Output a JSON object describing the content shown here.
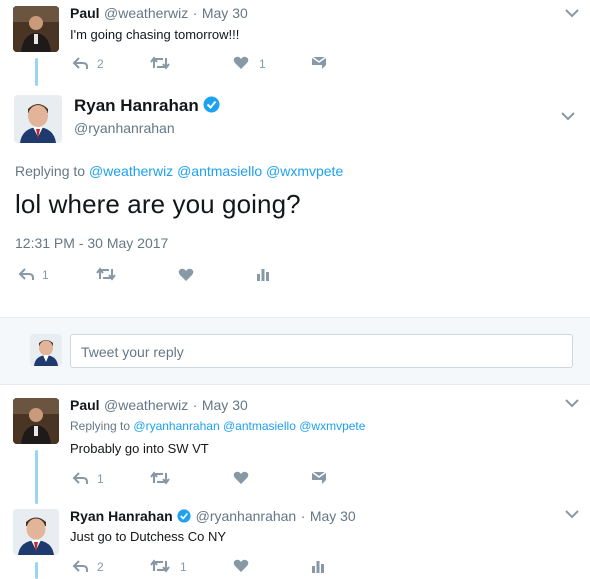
{
  "tweet1": {
    "name": "Paul",
    "handle": "@weatherwiz",
    "sep": "·",
    "date": "May 30",
    "text": "I'm going chasing tomorrow!!!",
    "reply_count": "2",
    "like_count": "1"
  },
  "main": {
    "name": "Ryan Hanrahan",
    "handle": "@ryanhanrahan",
    "replying_label": "Replying to",
    "mentions": [
      "@weatherwiz",
      "@antmasiello",
      "@wxmvpete"
    ],
    "text": "lol where are you going?",
    "timestamp": "12:31 PM - 30 May 2017",
    "reply_count": "1"
  },
  "composer": {
    "placeholder": "Tweet your reply"
  },
  "tweet3": {
    "name": "Paul",
    "handle": "@weatherwiz",
    "sep": "·",
    "date": "May 30",
    "replying_label": "Replying to",
    "mentions": [
      "@ryanhanrahan",
      "@antmasiello",
      "@wxmvpete"
    ],
    "text": "Probably go into SW VT",
    "reply_count": "1"
  },
  "tweet4": {
    "name": "Ryan Hanrahan",
    "handle": "@ryanhanrahan",
    "sep": "·",
    "date": "May 30",
    "text": "Just go to Dutchess Co NY",
    "reply_count": "2",
    "retweet_count": "1"
  },
  "colors": {
    "accent": "#1da1f2",
    "thread_line": "#9ad4f3",
    "muted": "#657786"
  }
}
